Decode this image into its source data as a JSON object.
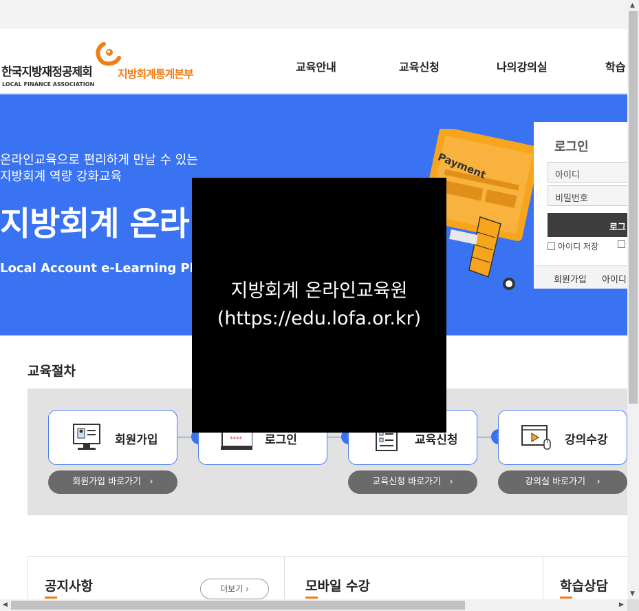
{
  "header": {
    "logo_ko": "한국지방재정공제회",
    "logo_en": "LOCAL FINANCE ASSOCIATION",
    "logo_dept": "지방회계통계본부",
    "nav": [
      "교육안내",
      "교육신청",
      "나의강의실",
      "학습"
    ]
  },
  "hero": {
    "subtitle_line1": "온라인교육으로 편리하게 만날 수 있는",
    "subtitle_line2": "지방회계 역량 강화교육",
    "title": "지방회계 온라",
    "english": "Local Account e-Learning Pl",
    "illustration_text": "Payment"
  },
  "login": {
    "title": "로그인",
    "id_placeholder": "아이디",
    "pw_placeholder": "비밀번호",
    "button": "로그",
    "save_id": "아이디 저장",
    "join": "회원가입",
    "find_id": "아이디"
  },
  "procedure": {
    "title": "교육절차",
    "steps": [
      {
        "label": "회원가입",
        "icon": "computer-user-icon",
        "link": "회원가입 바로가기"
      },
      {
        "label": "로그인",
        "icon": "password-monitor-icon",
        "link": ""
      },
      {
        "label": "교육신청",
        "icon": "clipboard-icon",
        "link": "교육신청 바로가기"
      },
      {
        "label": "강의수강",
        "icon": "video-player-icon",
        "link": "강의실 바로가기"
      }
    ],
    "password_mask": "****"
  },
  "bottom": {
    "notice_title": "공지사항",
    "more": "더보기",
    "mobile_title": "모바일 수강",
    "consult_title": "학습상담"
  },
  "overlay": {
    "line1": "지방회계 온라인교육원",
    "line2": "(https://edu.lofa.or.kr)"
  },
  "colors": {
    "hero_blue": "#3a73f1",
    "accent_orange": "#f07d16",
    "dark_button": "#3d3d3d"
  }
}
